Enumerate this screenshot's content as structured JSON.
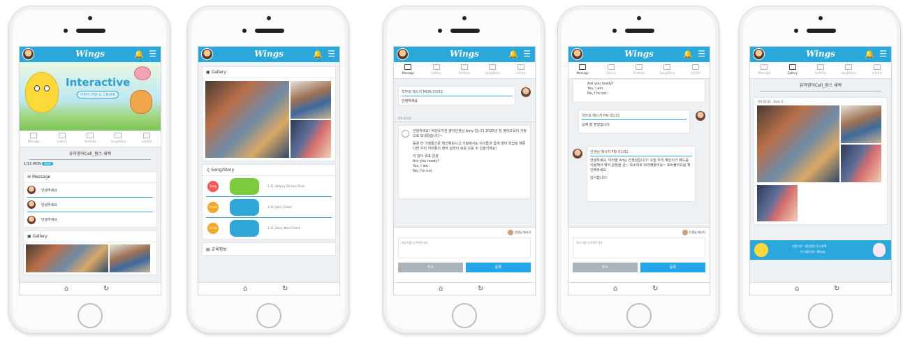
{
  "app": {
    "logo": "Wings",
    "home_icon": "home-icon",
    "refresh_icon": "refresh-icon",
    "accent": "#2aa8dc"
  },
  "tabs": [
    "Message",
    "Gallery",
    "Portfolio",
    "Song/Story",
    "교육정보"
  ],
  "phone1": {
    "banner_title": "Interactive",
    "banner_sub": "어린이 리딩 & 스토리북",
    "class_title": "유아영어Cell_원스 새싹",
    "date": "1/13 MON",
    "date_badge": "NEW",
    "message_header": "Message",
    "messages": [
      "안녕하세요",
      "안녕하세요",
      "안녕하세요"
    ],
    "gallery_header": "Gallery"
  },
  "phone2": {
    "gallery_header": "Gallery",
    "song_header": "Song/Story",
    "songs": [
      {
        "badge": "Song",
        "thumb": "",
        "label": "3.11_Hickory Dickory Dock"
      },
      {
        "badge": "Chant",
        "thumb": "",
        "label": "3.11_Story Chant"
      },
      {
        "badge": "Chant",
        "thumb": "",
        "label": "3.11_Story Word Chant"
      }
    ],
    "edu_header": "교육정보"
  },
  "phone3": {
    "parent_label": "학부모 메시지 MON 03/30",
    "parent_msg": "안녕하세요",
    "date_label": "FRI 01/31",
    "teacher_text": "안녕하세요! 박성유치원 영어선생님 Amy 입니다 2020년 첫 영어교육이 가정으로 보내졌습니다~",
    "teacher_text2": "등원 한 가정통신문 확인해보시고 가정에서도 아이들과 함께 영어 학습을 해준다면 우리 아이들의 영어 실력이 쑥쑥 오를 수 있을거예요!",
    "teacher_text3": "이 달의 목표 문장",
    "teacher_text4": "Are you ready?",
    "teacher_text5": "Yes, I am.",
    "teacher_text6": "No, I'm not.",
    "sender": "선생님 메시지",
    "input_placeholder": "메시지를 입력해주세요",
    "cancel": "취소",
    "send": "등록"
  },
  "phone4": {
    "top_text": "Are you ready?",
    "top_text2": "Yes, I am.",
    "top_text3": "No, I'm not.",
    "parent_label": "학부모 메시지 FRI 01/31",
    "parent_msg": "교재 잘 받았습니다",
    "teacher_label": "선생님 메시지 FRI 01/31",
    "teacher_msg": "안녕하세요, 여러분 Amy 선생님입니다! 오늘 우리 해인이가 패드를 이용해서 영어 문장을 큰~ 목소리로 따라해봤어요~ 포트폴리오를 확인해주세요.",
    "teacher_msg2": "감사합니다!",
    "sender": "선생님 메시지",
    "input_placeholder": "메시지를 입력해주세요",
    "cancel": "취소",
    "send": "등록"
  },
  "phone5": {
    "class_title": "유아영어Cell_원스 새싹",
    "date_label": "FRI 01/31 · Sort: 6",
    "footer_line1": "지원기관 : 재단법인 주소창팩",
    "footer_line2": "이 어플리케 : Wings"
  }
}
